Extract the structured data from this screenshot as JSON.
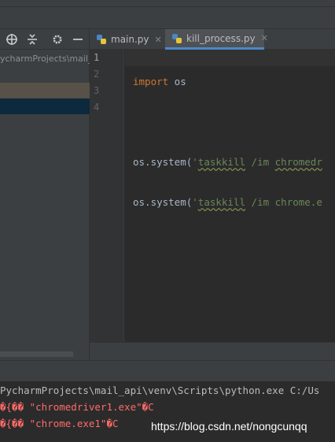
{
  "project_panel": {
    "path_text": "ycharmProjects\\mail_"
  },
  "tabs": [
    {
      "label": "main.py",
      "active": false
    },
    {
      "label": "kill_process.py",
      "active": true
    }
  ],
  "editor": {
    "line_numbers": [
      "1",
      "2",
      "3",
      "4"
    ],
    "lines": {
      "l1": {
        "kw": "import",
        "rest": " os"
      },
      "l3": {
        "call": "os.system(",
        "q": "'",
        "cmd": "taskkill",
        "args": " /im ",
        "target": "chromedr"
      },
      "l4": {
        "call": "os.system(",
        "q": "'",
        "cmd": "taskkill",
        "args": " /im chrome.e"
      }
    }
  },
  "console": {
    "path_line": "PycharmProjects\\mail_api\\venv\\Scripts\\python.exe C:/Us",
    "err1": "�{�� \"chromedriver1.exe\"�C",
    "err2": "�{�� \"chrome.exe1\"�C"
  },
  "watermark": "https://blog.csdn.net/nongcunqq",
  "colors": {
    "background": "#2b2b2b",
    "panel": "#3c3f41",
    "keyword": "#cc7832",
    "string": "#6a8759",
    "error_text": "#ff6b68",
    "active_tab_underline": "#4a88c7"
  },
  "icons": {
    "toolbar": [
      "locate-icon",
      "collapse-icon",
      "gear-icon",
      "minimize-icon"
    ],
    "tab": "python-file-icon",
    "tab_close": "close-icon"
  }
}
